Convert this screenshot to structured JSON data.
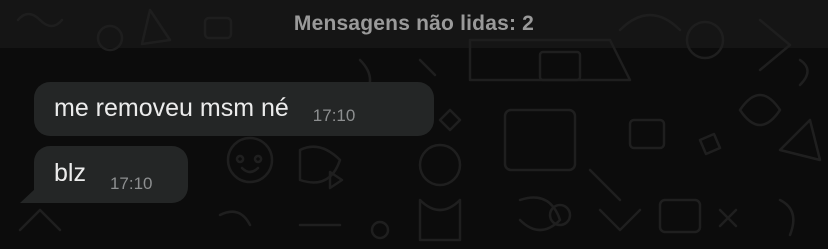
{
  "banner": {
    "text": "Mensagens não lidas: 2"
  },
  "messages": [
    {
      "text": "me removeu msm né",
      "time": "17:10"
    },
    {
      "text": "blz",
      "time": "17:10"
    }
  ],
  "colors": {
    "background": "#0c0c0c",
    "bubble": "#242626",
    "message_text": "#ececec",
    "time_text": "#8d8f90",
    "banner_text": "#9a9a9a"
  },
  "wallpaper": {
    "icon": "doodle-pattern"
  }
}
